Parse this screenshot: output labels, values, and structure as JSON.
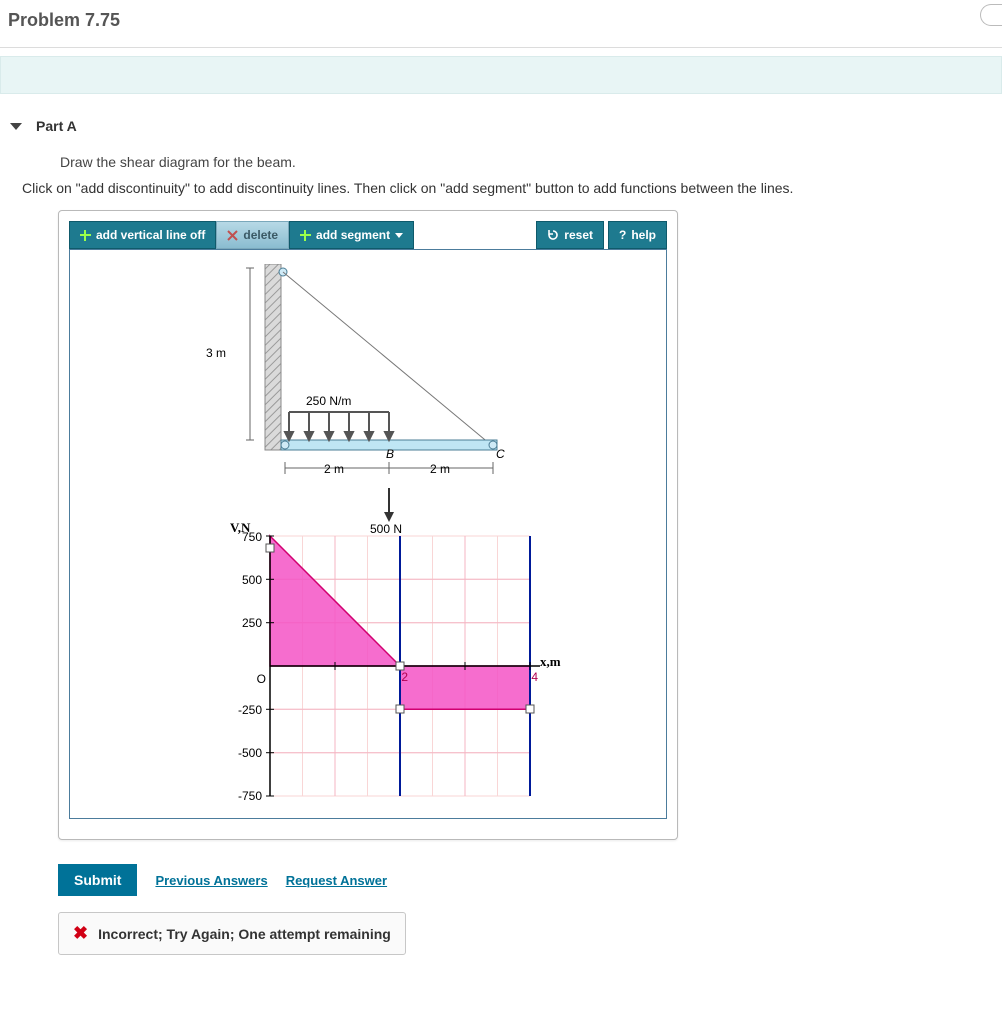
{
  "header": {
    "title": "Problem 7.75"
  },
  "part": {
    "label": "Part A"
  },
  "prompt": "Draw the shear diagram for the beam.",
  "instructions": "Click on \"add discontinuity\" to add discontinuity lines. Then click on \"add segment\" button to add functions between the lines.",
  "toolbar": {
    "add_vertical": "add vertical line off",
    "delete": "delete",
    "add_segment": "add segment",
    "reset": "reset",
    "help": "help"
  },
  "beam": {
    "vertical_dim": "3 m",
    "dist_load": "250 N/m",
    "span_left": "2 m",
    "span_right": "2 m",
    "label_B": "B",
    "label_C": "C",
    "point_load": "500 N"
  },
  "chart_data": {
    "type": "area",
    "title": "",
    "xlabel": "x,m",
    "ylabel": "V,N",
    "xlim": [
      0,
      4
    ],
    "ylim": [
      -750,
      750
    ],
    "x_ticks": [
      "O",
      "2",
      "4"
    ],
    "y_ticks": [
      750,
      500,
      250,
      -250,
      -500,
      -750
    ],
    "discontinuity_x": [
      2,
      4
    ],
    "series": [
      {
        "name": "segment1",
        "x": [
          0,
          2
        ],
        "y": [
          750,
          0
        ]
      },
      {
        "name": "segment2",
        "x": [
          2,
          4
        ],
        "y": [
          -250,
          -250
        ]
      }
    ]
  },
  "actions": {
    "submit": "Submit",
    "previous_answers": "Previous Answers",
    "request_answer": "Request Answer"
  },
  "feedback": {
    "text": "Incorrect; Try Again; One attempt remaining"
  }
}
